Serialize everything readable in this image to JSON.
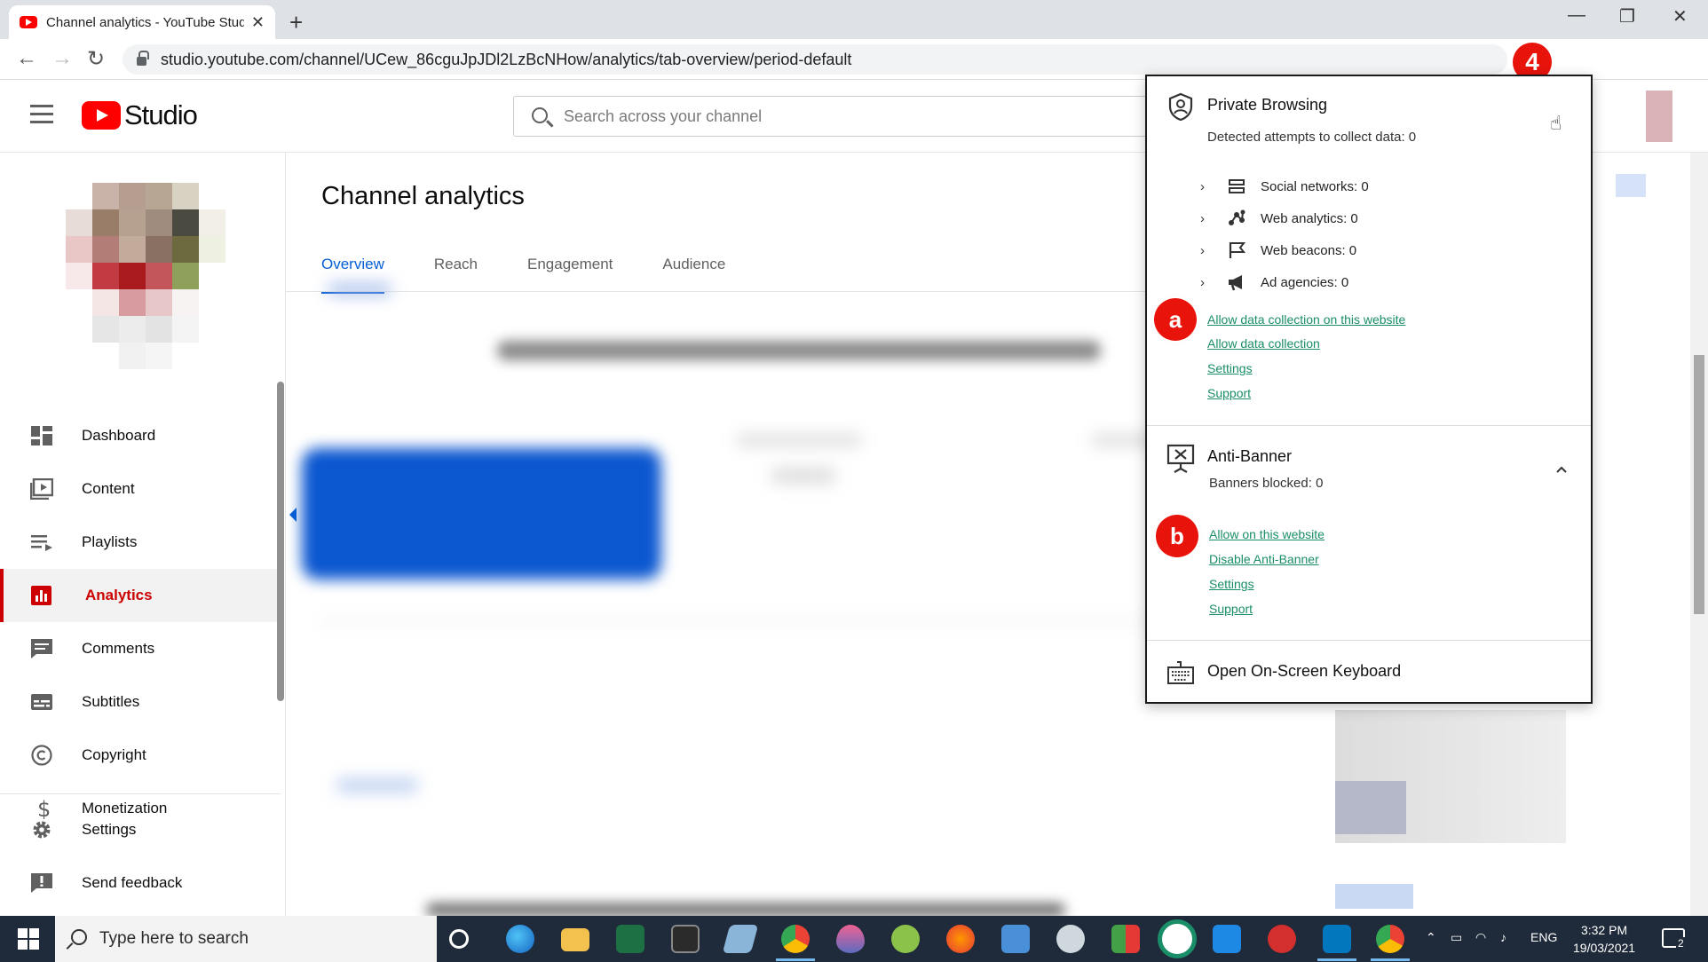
{
  "browser": {
    "tab_title": "Channel analytics - YouTube Studio",
    "tab_close": "✕",
    "new_tab": "+",
    "url": "studio.youtube.com/channel/UCew_86cguJpJDl2LzBcNHow/analytics/tab-overview/period-default",
    "back": "←",
    "forward": "→",
    "reload": "↻",
    "minimize": "—",
    "maximize": "❐",
    "close": "✕",
    "extension_count": "1",
    "menu": "⋮"
  },
  "annotation": {
    "step_number": "4",
    "marker_a": "a",
    "marker_b": "b"
  },
  "studio": {
    "logo_text": "Studio",
    "search_placeholder": "Search across your channel"
  },
  "sidebar": {
    "items": [
      {
        "label": "Dashboard",
        "icon": "dashboard-icon"
      },
      {
        "label": "Content",
        "icon": "content-icon"
      },
      {
        "label": "Playlists",
        "icon": "playlists-icon"
      },
      {
        "label": "Analytics",
        "icon": "analytics-icon",
        "active": true
      },
      {
        "label": "Comments",
        "icon": "comments-icon"
      },
      {
        "label": "Subtitles",
        "icon": "subtitles-icon"
      },
      {
        "label": "Copyright",
        "icon": "copyright-icon"
      },
      {
        "label": "Monetization",
        "icon": "monetization-icon"
      },
      {
        "label": "Settings",
        "icon": "gear-icon"
      },
      {
        "label": "Send feedback",
        "icon": "feedback-icon"
      }
    ]
  },
  "main": {
    "title": "Channel analytics",
    "tabs": [
      {
        "label": "Overview",
        "active": true
      },
      {
        "label": "Reach"
      },
      {
        "label": "Engagement"
      },
      {
        "label": "Audience"
      }
    ]
  },
  "popup": {
    "private_browsing": {
      "title": "Private Browsing",
      "subtitle": "Detected attempts to collect data: 0",
      "trackers": [
        {
          "label": "Social networks: 0",
          "icon": "social-networks-icon"
        },
        {
          "label": "Web analytics: 0",
          "icon": "web-analytics-icon"
        },
        {
          "label": "Web beacons: 0",
          "icon": "web-beacons-icon"
        },
        {
          "label": "Ad agencies: 0",
          "icon": "ad-agencies-icon"
        }
      ],
      "links": [
        "Allow data collection on this website",
        "Allow data collection",
        "Settings",
        "Support"
      ]
    },
    "anti_banner": {
      "title": "Anti-Banner",
      "subtitle": "Banners blocked: 0",
      "links": [
        "Allow on this website",
        "Disable Anti-Banner",
        "Settings",
        "Support"
      ]
    },
    "keyboard": {
      "title": "Open On-Screen Keyboard"
    }
  },
  "taskbar": {
    "search_placeholder": "Type here to search",
    "language": "ENG",
    "time": "3:32 PM",
    "date": "19/03/2021",
    "notifications": "2"
  },
  "colors": {
    "youtube_red": "#ff0000",
    "active_blue": "#065fd4",
    "link_green": "#1a8e68",
    "marker_red": "#e8140c"
  }
}
